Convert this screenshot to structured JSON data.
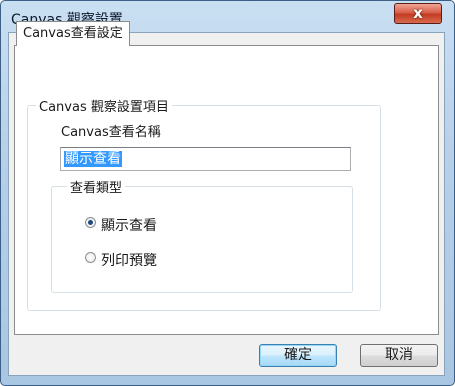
{
  "window": {
    "title": "Canvas 觀察設置",
    "close_symbol": "x"
  },
  "tab": {
    "label": "Canvas查看設定"
  },
  "group_properties": {
    "legend": "Canvas 觀察設置項目",
    "name_label": "Canvas查看名稱",
    "name_value": "顯示查看"
  },
  "group_view_type": {
    "legend": "查看類型",
    "options": [
      {
        "label": "顯示查看",
        "selected": true
      },
      {
        "label": "列印預覽",
        "selected": false
      }
    ]
  },
  "buttons": {
    "ok": "確定",
    "cancel": "取消"
  },
  "colors": {
    "accent_selection": "#3399ff",
    "close_button": "#c23b22",
    "window_frame": "#b7d0e8"
  }
}
